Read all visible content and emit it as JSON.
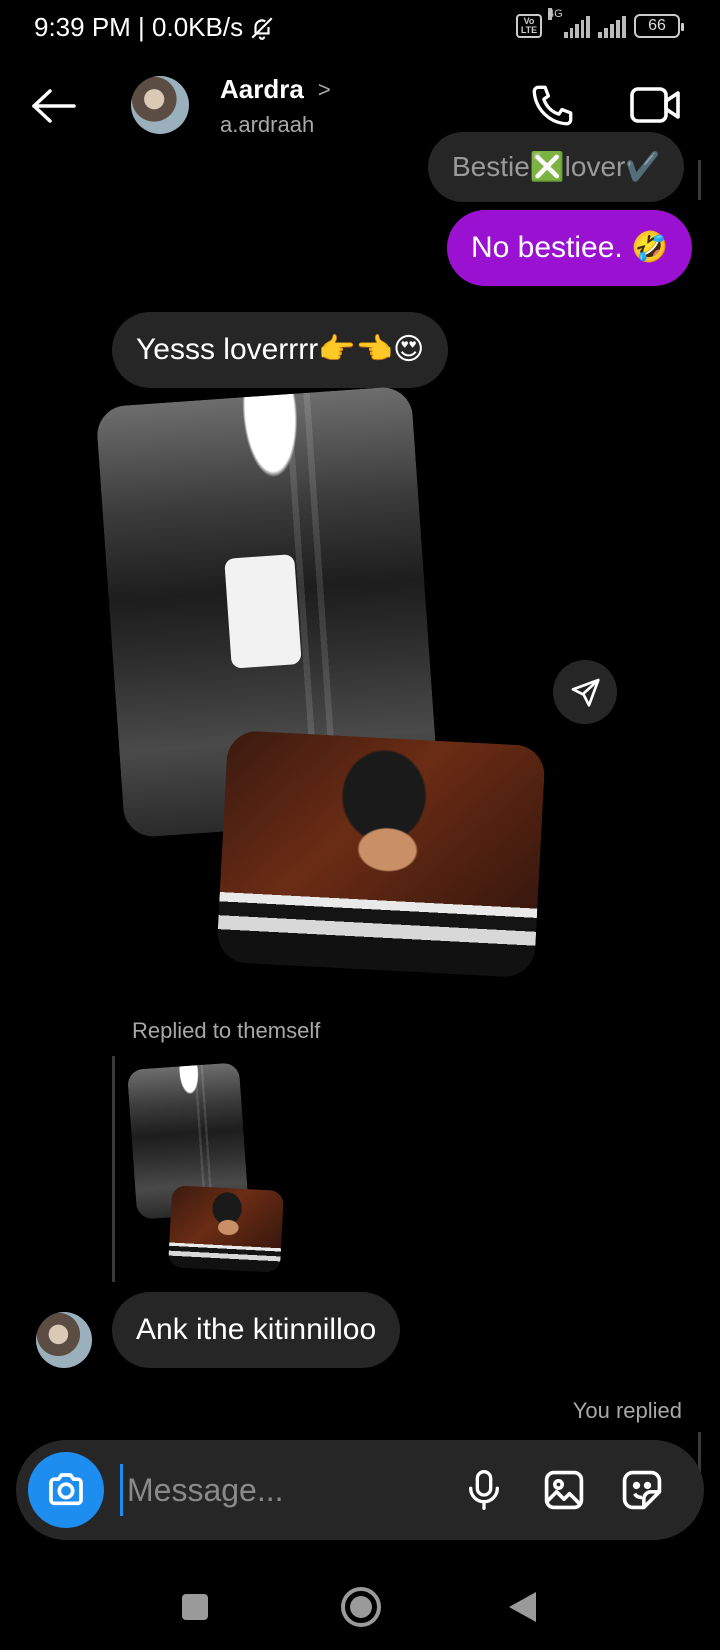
{
  "status": {
    "time_speed": "9:39 PM | 0.0KB/s",
    "volte": "Vo LTE",
    "network": "4G",
    "battery": "66"
  },
  "header": {
    "name": "Aardra",
    "handle": "a.ardraah",
    "chevron": ">"
  },
  "messages": {
    "previous": "Bestie❎lover✔️",
    "sent": "No bestiee. 🤣",
    "received_1": "Yesss loverrrr👉👈😍",
    "reply_label": "Replied to themself",
    "received_2": "Ank ithe kitinnilloo",
    "you_replied": "You replied"
  },
  "composer": {
    "placeholder": "Message..."
  },
  "colors": {
    "sent_bubble": "#9b11d1",
    "received_bubble": "#262626",
    "camera_button": "#1d8ef0",
    "background": "#000000"
  },
  "icons": {
    "back": "back-arrow-icon",
    "call": "phone-icon",
    "video": "video-camera-icon",
    "share": "send-icon",
    "camera": "camera-icon",
    "mic": "microphone-icon",
    "gallery": "image-icon",
    "sticker": "sticker-icon"
  }
}
